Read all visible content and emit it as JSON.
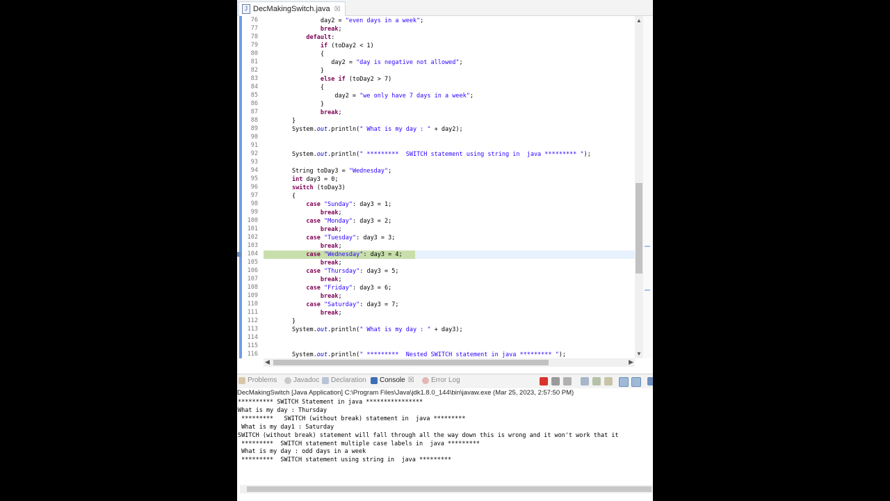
{
  "editor": {
    "tab_label": "DecMakingSwitch.java",
    "tab_icon": "J",
    "close_glyph": "☒",
    "lines": [
      {
        "n": "76",
        "text": "                day2 = \"even days in a week\";"
      },
      {
        "n": "77",
        "text": "                break;"
      },
      {
        "n": "78",
        "text": "            default:"
      },
      {
        "n": "79",
        "text": "                if (toDay2 < 1)"
      },
      {
        "n": "80",
        "text": "                {"
      },
      {
        "n": "81",
        "text": "                   day2 = \"day is negative not allowed\";"
      },
      {
        "n": "82",
        "text": "                }"
      },
      {
        "n": "83",
        "text": "                else if (toDay2 > 7)"
      },
      {
        "n": "84",
        "text": "                {"
      },
      {
        "n": "85",
        "text": "                    day2 = \"we only have 7 days in a week\";"
      },
      {
        "n": "86",
        "text": "                }"
      },
      {
        "n": "87",
        "text": "                break;"
      },
      {
        "n": "88",
        "text": "        }"
      },
      {
        "n": "89",
        "text": "        System.out.println(\" What is my day : \" + day2);"
      },
      {
        "n": "90",
        "text": ""
      },
      {
        "n": "91",
        "text": ""
      },
      {
        "n": "92",
        "text": "        System.out.println(\" *********  SWITCH statement using string in  java ********* \");"
      },
      {
        "n": "93",
        "text": ""
      },
      {
        "n": "94",
        "text": "        String toDay3 = \"Wednesday\";"
      },
      {
        "n": "95",
        "text": "        int day3 = 0;"
      },
      {
        "n": "96",
        "text": "        switch (toDay3)"
      },
      {
        "n": "97",
        "text": "        {"
      },
      {
        "n": "98",
        "text": "            case \"Sunday\": day3 = 1;"
      },
      {
        "n": "99",
        "text": "                break;"
      },
      {
        "n": "100",
        "text": "            case \"Monday\": day3 = 2;"
      },
      {
        "n": "101",
        "text": "                break;"
      },
      {
        "n": "102",
        "text": "            case \"Tuesday\": day3 = 3;"
      },
      {
        "n": "103",
        "text": "                break;"
      },
      {
        "n": "104",
        "text": "            case \"Wednesday\": day3 = 4;"
      },
      {
        "n": "105",
        "text": "                break;"
      },
      {
        "n": "106",
        "text": "            case \"Thursday\": day3 = 5;"
      },
      {
        "n": "107",
        "text": "                break;"
      },
      {
        "n": "108",
        "text": "            case \"Friday\": day3 = 6;"
      },
      {
        "n": "109",
        "text": "                break;"
      },
      {
        "n": "110",
        "text": "            case \"Saturday\": day3 = 7;"
      },
      {
        "n": "111",
        "text": "                break;"
      },
      {
        "n": "112",
        "text": "        }"
      },
      {
        "n": "113",
        "text": "        System.out.println(\" What is my day : \" + day3);"
      },
      {
        "n": "114",
        "text": ""
      },
      {
        "n": "115",
        "text": ""
      },
      {
        "n": "116",
        "text": "        System.out.println(\" *********  Nested SWITCH statement in java ********* \");"
      }
    ],
    "highlighted_line": "104",
    "colors": {
      "keyword": "#7f0055",
      "string": "#2a00ff",
      "field": "#0000c0",
      "highlight": "#c8dfac",
      "ruler": "#6e9ee8"
    }
  },
  "console": {
    "tabs": [
      {
        "label": "Problems",
        "icon": "problems-icon",
        "active": false
      },
      {
        "label": "Javadoc",
        "icon": "javadoc-icon",
        "active": false
      },
      {
        "label": "Declaration",
        "icon": "declaration-icon",
        "active": false
      },
      {
        "label": "Console",
        "icon": "console-icon",
        "active": true
      },
      {
        "label": "Error Log",
        "icon": "error-log-icon",
        "active": false
      }
    ],
    "close_glyph": "☒",
    "launch_info": "DecMakingSwitch [Java Application] C:\\Program Files\\Java\\jdk1.8.0_144\\bin\\javaw.exe (Mar 25, 2023, 2:57:50 PM)",
    "output": [
      "********** SWITCH Statement in java ****************",
      "What is my day : Thursday",
      " *********   SWITCH (without break) statement in  java *********",
      " What is my day1 : Saturday",
      "SWITCH (without break) statement will fall through all the way down this is wrong and it won't work that it",
      " *********  SWITCH statement multiple case labels in  java *********",
      " What is my day : odd days in a week",
      " *********  SWITCH statement using string in  java *********"
    ]
  }
}
